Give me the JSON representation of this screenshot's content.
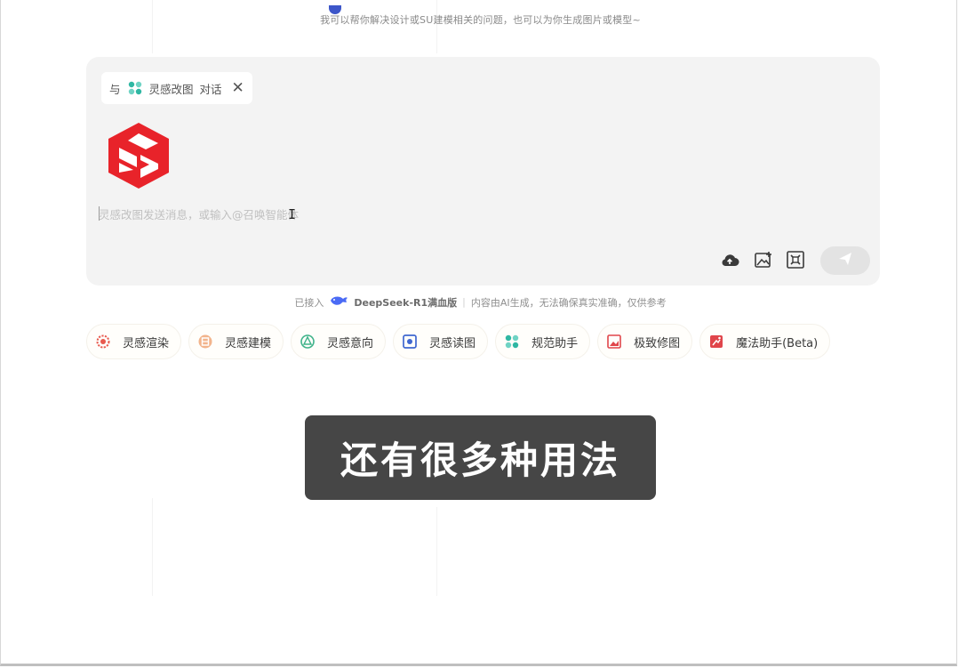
{
  "top_hint": {
    "text": "我可以帮你解决设计或SU建模相关的问题，也可以为你生成图片或模型~"
  },
  "chat": {
    "chip_prefix": "与",
    "agent_name": "灵感改图",
    "chip_suffix": "对话",
    "close_glyph": "✕",
    "input_placeholder": "灵感改图发送消息，或输入@召唤智能体",
    "ibeam_glyph": "I"
  },
  "footer": {
    "connected_label": "已接入",
    "model_name": "DeepSeek-R1满血版",
    "separator": "|",
    "disclaimer": "内容由AI生成，无法确保真实准确，仅供参考"
  },
  "quick_tools": [
    {
      "label": "灵感渲染",
      "icon": "render-gear-icon",
      "color": "#e85a4f"
    },
    {
      "label": "灵感建模",
      "icon": "modeling-icon",
      "color": "#e08a5a"
    },
    {
      "label": "灵感意向",
      "icon": "intent-icon",
      "color": "#3fb38a"
    },
    {
      "label": "灵感读图",
      "icon": "read-image-icon",
      "color": "#3f67d0"
    },
    {
      "label": "规范助手",
      "icon": "spec-helper-icon",
      "color": "#2fb7a3"
    },
    {
      "label": "极致修图",
      "icon": "edit-image-icon",
      "color": "#e0454a"
    },
    {
      "label": "魔法助手(Beta)",
      "icon": "magic-helper-icon",
      "color": "#e0454a"
    }
  ],
  "subtitle": {
    "text": "还有很多种用法"
  },
  "colors": {
    "brand_red": "#e8232a",
    "card_bg": "#f3f3f3",
    "send_bg": "#e3e3e3"
  }
}
